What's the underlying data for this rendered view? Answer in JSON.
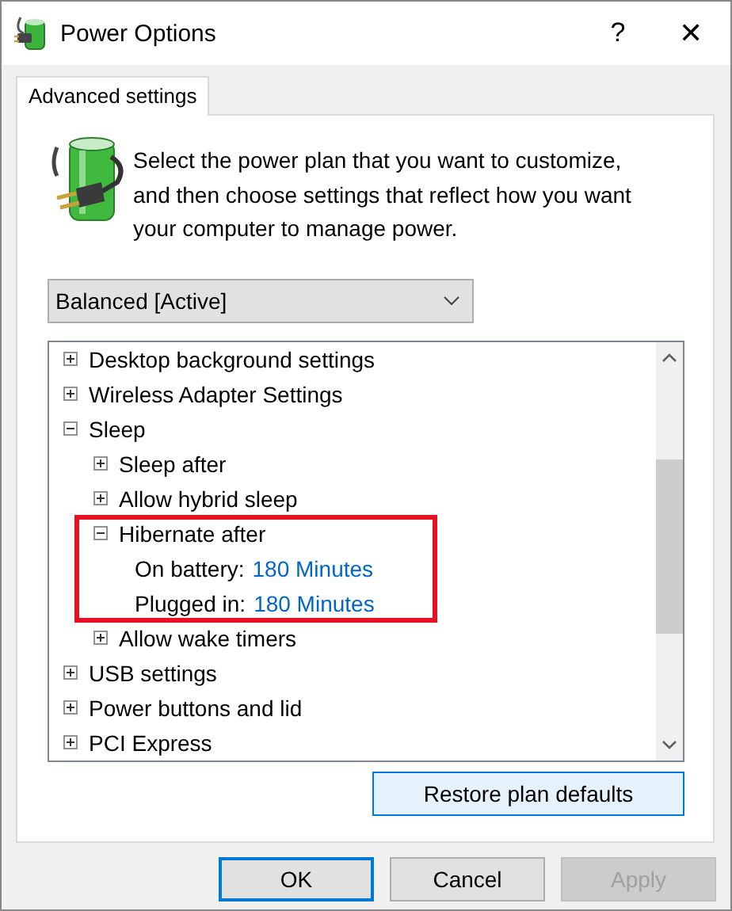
{
  "window": {
    "title": "Power Options",
    "help": "?",
    "close": "✕"
  },
  "tabs": [
    {
      "label": "Advanced settings",
      "selected": true
    }
  ],
  "description": "Select the power plan that you want to customize, and then choose settings that reflect how you want your computer to manage power.",
  "plan_dropdown": {
    "value": "Balanced [Active]"
  },
  "settings_tree": [
    {
      "kind": "group",
      "label": "Desktop background settings",
      "expanded": false
    },
    {
      "kind": "group",
      "label": "Wireless Adapter Settings",
      "expanded": false
    },
    {
      "kind": "group",
      "label": "Sleep",
      "expanded": true,
      "children": [
        {
          "kind": "group",
          "label": "Sleep after",
          "expanded": false
        },
        {
          "kind": "group",
          "label": "Allow hybrid sleep",
          "expanded": false
        },
        {
          "kind": "group",
          "label": "Hibernate after",
          "expanded": true,
          "highlighted": true,
          "children": [
            {
              "kind": "value",
              "label": "On battery:",
              "value": "180 Minutes"
            },
            {
              "kind": "value",
              "label": "Plugged in:",
              "value": "180 Minutes"
            }
          ]
        },
        {
          "kind": "group",
          "label": "Allow wake timers",
          "expanded": false
        }
      ]
    },
    {
      "kind": "group",
      "label": "USB settings",
      "expanded": false
    },
    {
      "kind": "group",
      "label": "Power buttons and lid",
      "expanded": false
    },
    {
      "kind": "group",
      "label": "PCI Express",
      "expanded": false
    }
  ],
  "restore_button": {
    "label": "Restore plan defaults"
  },
  "buttons": [
    {
      "label": "OK",
      "default": true,
      "disabled": false
    },
    {
      "label": "Cancel",
      "default": false,
      "disabled": false
    },
    {
      "label": "Apply",
      "default": false,
      "disabled": true
    }
  ]
}
